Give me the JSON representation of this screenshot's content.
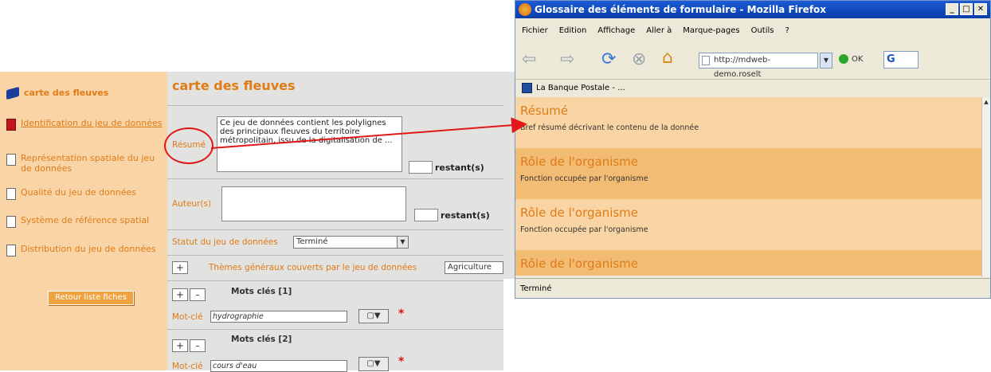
{
  "left_app": {
    "sidebar": {
      "heading": "carte des fleuves",
      "items": [
        {
          "label": "Identification du jeu de données"
        },
        {
          "label": "Représentation spatiale du jeu de données"
        },
        {
          "label": "Qualité du jeu de données"
        },
        {
          "label": "Système de référence spatial"
        },
        {
          "label": "Distribution du jeu de données"
        }
      ],
      "back_button": "Retour liste fiches"
    },
    "main": {
      "title": "carte des fleuves",
      "resume_label": "Résumé",
      "resume_text": "Ce jeu de données contient  les polylignes des principaux fleuves du territoire métropolitain, issu de la digitalisation de ...",
      "restant": "restant(s)",
      "auteur_label": "Auteur(s)",
      "statut_label": "Statut du jeu de données",
      "statut_value": "Terminé",
      "plus": "+",
      "minus": "-",
      "themes_label": "Thèmes généraux couverts par le jeu de données",
      "themes_value": "Agriculture",
      "motscles_1": "Mots clés [1]",
      "motscles_2": "Mots clés [2]",
      "motcle_label": "Mot-clé",
      "motcle_1_value": "hydrographie",
      "motcle_2_value": "cours d'eau",
      "required": "*"
    }
  },
  "firefox": {
    "title": "Glossaire des éléments de formulaire - Mozilla Firefox",
    "menu": [
      "Fichier",
      "Edition",
      "Affichage",
      "Aller à",
      "Marque-pages",
      "Outils",
      "?"
    ],
    "url": "http://mdweb-demo.roselt",
    "ok": "OK",
    "bookmark": "La Banque Postale - ...",
    "sections": [
      {
        "title": "Résumé",
        "desc": "Bref résumé décrivant le contenu de la donnée"
      },
      {
        "title": "Rôle de l'organisme",
        "desc": "Fonction occupée par l'organisme"
      },
      {
        "title": "Rôle de l'organisme",
        "desc": "Fonction occupée par l'organisme"
      },
      {
        "title": "Rôle de l'organisme",
        "desc": ""
      }
    ],
    "status": "Terminé"
  },
  "colors": {
    "accent": "#e07b16",
    "sidebar": "#f9d4a6",
    "annotation": "#e01818"
  }
}
